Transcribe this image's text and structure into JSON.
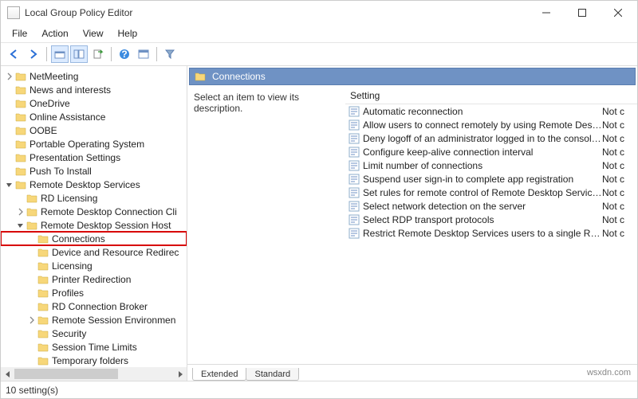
{
  "window": {
    "title": "Local Group Policy Editor"
  },
  "menu": {
    "file": "File",
    "action": "Action",
    "view": "View",
    "help": "Help"
  },
  "tree": [
    {
      "label": "NetMeeting",
      "indent": 0,
      "chev": "closed"
    },
    {
      "label": "News and interests",
      "indent": 0,
      "chev": "none"
    },
    {
      "label": "OneDrive",
      "indent": 0,
      "chev": "none"
    },
    {
      "label": "Online Assistance",
      "indent": 0,
      "chev": "none"
    },
    {
      "label": "OOBE",
      "indent": 0,
      "chev": "none"
    },
    {
      "label": "Portable Operating System",
      "indent": 0,
      "chev": "none"
    },
    {
      "label": "Presentation Settings",
      "indent": 0,
      "chev": "none"
    },
    {
      "label": "Push To Install",
      "indent": 0,
      "chev": "none"
    },
    {
      "label": "Remote Desktop Services",
      "indent": 0,
      "chev": "open"
    },
    {
      "label": "RD Licensing",
      "indent": 1,
      "chev": "none"
    },
    {
      "label": "Remote Desktop Connection Cli",
      "indent": 1,
      "chev": "closed"
    },
    {
      "label": "Remote Desktop Session Host",
      "indent": 1,
      "chev": "open"
    },
    {
      "label": "Connections",
      "indent": 2,
      "chev": "none",
      "highlight": true
    },
    {
      "label": "Device and Resource Redirec",
      "indent": 2,
      "chev": "none"
    },
    {
      "label": "Licensing",
      "indent": 2,
      "chev": "none"
    },
    {
      "label": "Printer Redirection",
      "indent": 2,
      "chev": "none"
    },
    {
      "label": "Profiles",
      "indent": 2,
      "chev": "none"
    },
    {
      "label": "RD Connection Broker",
      "indent": 2,
      "chev": "none"
    },
    {
      "label": "Remote Session Environmen",
      "indent": 2,
      "chev": "closed"
    },
    {
      "label": "Security",
      "indent": 2,
      "chev": "none"
    },
    {
      "label": "Session Time Limits",
      "indent": 2,
      "chev": "none"
    },
    {
      "label": "Temporary folders",
      "indent": 2,
      "chev": "none"
    }
  ],
  "panel": {
    "title": "Connections",
    "desc": "Select an item to view its description.",
    "col_setting": "Setting",
    "col_state_trunc": "Not c"
  },
  "settings": [
    {
      "name": "Automatic reconnection",
      "state": "Not c"
    },
    {
      "name": "Allow users to connect remotely by using Remote Desktop S...",
      "state": "Not c"
    },
    {
      "name": "Deny logoff of an administrator logged in to the console ses...",
      "state": "Not c"
    },
    {
      "name": "Configure keep-alive connection interval",
      "state": "Not c"
    },
    {
      "name": "Limit number of connections",
      "state": "Not c"
    },
    {
      "name": "Suspend user sign-in to complete app registration",
      "state": "Not c"
    },
    {
      "name": "Set rules for remote control of Remote Desktop Services use...",
      "state": "Not c"
    },
    {
      "name": "Select network detection on the server",
      "state": "Not c"
    },
    {
      "name": "Select RDP transport protocols",
      "state": "Not c"
    },
    {
      "name": "Restrict Remote Desktop Services users to a single Remote D...",
      "state": "Not c"
    }
  ],
  "tabs": {
    "extended": "Extended",
    "standard": "Standard"
  },
  "status": "10 setting(s)",
  "watermark": "wsxdn.com"
}
